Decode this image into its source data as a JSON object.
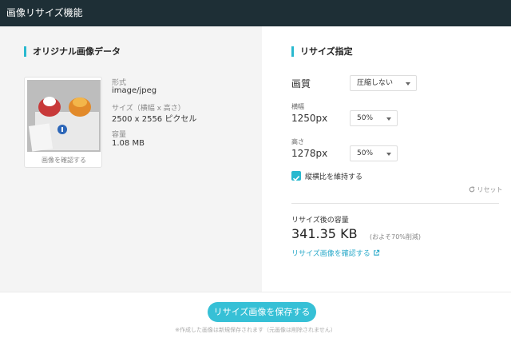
{
  "app": {
    "title": "画像リサイズ機能"
  },
  "original": {
    "section_title": "オリジナル画像データ",
    "thumb_caption": "画像を確認する",
    "format_label": "形式",
    "format_value": "image/jpeg",
    "size_label": "サイズ（横幅 x 高さ）",
    "size_value": "2500 x 2556 ピクセル",
    "filesize_label": "容量",
    "filesize_value": "1.08 MB"
  },
  "resize": {
    "section_title": "リサイズ指定",
    "quality_label": "画質",
    "quality_select": "圧縮しない",
    "width_label": "横幅",
    "width_value": "1250px",
    "width_select": "50%",
    "height_label": "高さ",
    "height_value": "1278px",
    "height_select": "50%",
    "keep_ratio_label": "縦横比を維持する",
    "reset_label": "リセット",
    "result_label": "リサイズ後の容量",
    "result_value": "341.35 KB",
    "result_note": "(およそ70%削減)",
    "confirm_link": "リサイズ画像を確認する"
  },
  "footer": {
    "save_button": "リサイズ画像を保存する",
    "note": "※作成した画像は新規保存されます（元画像は削除されません）"
  },
  "colors": {
    "accent": "#29b9cf",
    "titlebar": "#1e2f36",
    "panel": "#f4f4f4"
  }
}
